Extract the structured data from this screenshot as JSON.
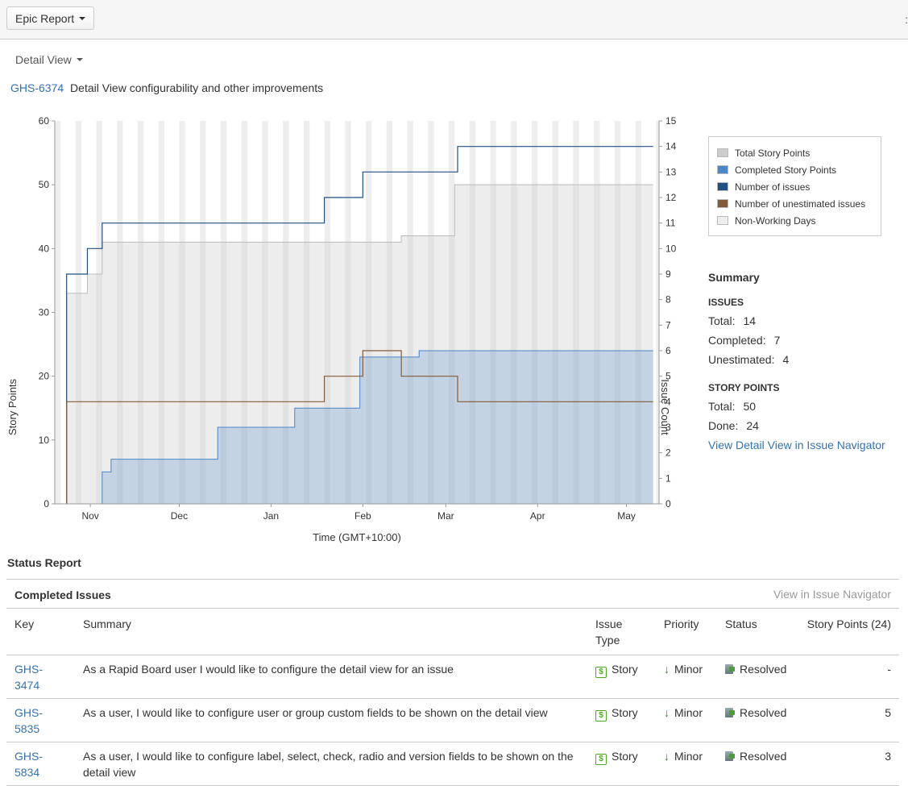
{
  "toolbar": {
    "report_button": "Epic Report"
  },
  "view": {
    "selector_label": "Detail View"
  },
  "epic": {
    "key": "GHS-6374",
    "title": "Detail View configurability and other improvements"
  },
  "colors": {
    "total_story_points": "#cccccc",
    "completed_story_points": "#4a86c8",
    "number_of_issues": "#205081",
    "number_of_unestimated_issues": "#815b3a",
    "non_working_days": "#eeeeee",
    "link": "#3572b0"
  },
  "chart_data": {
    "type": "line",
    "xlabel": "Time (GMT+10:00)",
    "ylabel": "Story Points",
    "y2label": "Issue Count",
    "x_ticks": [
      "Nov",
      "Dec",
      "Jan",
      "Feb",
      "Mar",
      "Apr",
      "May"
    ],
    "ylim": [
      0,
      60
    ],
    "y_ticks": [
      "0",
      "10",
      "20",
      "30",
      "40",
      "50",
      "60"
    ],
    "y2lim": [
      0,
      15
    ],
    "y2_ticks": [
      "0",
      "1",
      "2",
      "3",
      "4",
      "5",
      "6",
      "7",
      "8",
      "9",
      "10",
      "11",
      "12",
      "13",
      "14",
      "15"
    ],
    "series": [
      {
        "name": "Total Story Points",
        "axis": "left",
        "style": "step-area",
        "x": [
          "Oct 24",
          "Oct 31",
          "Nov 5",
          "Feb 14",
          "Mar 4",
          "May 10"
        ],
        "values": [
          33,
          36,
          41,
          42,
          50,
          50
        ]
      },
      {
        "name": "Completed Story Points",
        "axis": "left",
        "style": "step-area",
        "x": [
          "Nov 5",
          "Nov 8",
          "Dec 14",
          "Jan 9",
          "Jan 31",
          "Feb 20",
          "May 10"
        ],
        "values": [
          5,
          7,
          12,
          15,
          23,
          24,
          24
        ]
      },
      {
        "name": "Number of issues",
        "axis": "right",
        "style": "step-line",
        "x": [
          "Oct 24",
          "Oct 31",
          "Nov 5",
          "Jan 19",
          "Feb 1",
          "Mar 5",
          "May 10"
        ],
        "values": [
          9,
          10,
          11,
          12,
          13,
          14,
          14
        ]
      },
      {
        "name": "Number of unestimated issues",
        "axis": "right",
        "style": "step-line",
        "x": [
          "Oct 24",
          "Jan 19",
          "Feb 1",
          "Feb 14",
          "Mar 5",
          "May 10"
        ],
        "values": [
          4,
          5,
          6,
          5,
          4,
          4
        ]
      }
    ],
    "non_working_days": true,
    "legend_position": "right"
  },
  "legend": [
    {
      "label": "Total Story Points",
      "color": "#cccccc"
    },
    {
      "label": "Completed Story Points",
      "color": "#4a86c8"
    },
    {
      "label": "Number of issues",
      "color": "#205081"
    },
    {
      "label": "Number of unestimated issues",
      "color": "#815b3a"
    },
    {
      "label": "Non-Working Days",
      "color": "#eeeeee"
    }
  ],
  "summary": {
    "heading": "Summary",
    "issues_heading": "ISSUES",
    "total_label": "Total:",
    "total_value": "14",
    "completed_label": "Completed:",
    "completed_value": "7",
    "unestimated_label": "Unestimated:",
    "unestimated_value": "4",
    "points_heading": "STORY POINTS",
    "points_total_label": "Total:",
    "points_total_value": "50",
    "done_label": "Done:",
    "done_value": "24",
    "navigator_link": "View Detail View in Issue Navigator"
  },
  "status_report": {
    "heading": "Status Report",
    "completed_heading": "Completed Issues",
    "navigator_link": "View in Issue Navigator",
    "columns": {
      "key": "Key",
      "summary": "Summary",
      "issue_type_1": "Issue",
      "issue_type_2": "Type",
      "priority": "Priority",
      "status": "Status",
      "points": "Story Points (24)"
    },
    "rows": [
      {
        "key": "GHS-3474",
        "summary": "As a Rapid Board user I would like to configure the detail view for an issue",
        "type": "Story",
        "priority": "Minor",
        "status": "Resolved",
        "points": "-"
      },
      {
        "key": "GHS-5835",
        "summary": "As a user, I would like to configure user or group custom fields to be shown on the detail view",
        "type": "Story",
        "priority": "Minor",
        "status": "Resolved",
        "points": "5"
      },
      {
        "key": "GHS-5834",
        "summary": "As a user, I would like to configure label, select, check, radio and version fields to be shown on the detail view",
        "type": "Story",
        "priority": "Minor",
        "status": "Resolved",
        "points": "3"
      }
    ]
  }
}
